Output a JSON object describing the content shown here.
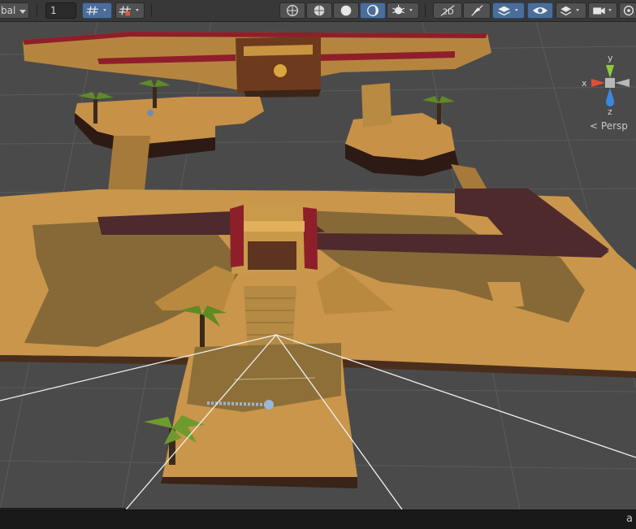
{
  "toolbar": {
    "pivot_rotation_label": "bal",
    "grid_snap_increment": "1",
    "buttons": [
      {
        "name": "grid-toggle-icon",
        "active": true
      },
      {
        "name": "incremental-snap-icon",
        "active": false
      },
      {
        "name": "draw-mode-wireframe-icon",
        "active": false
      },
      {
        "name": "draw-mode-shaded-wireframe-icon",
        "active": false
      },
      {
        "name": "draw-mode-shaded-icon",
        "active": false
      },
      {
        "name": "draw-mode-unlit-icon",
        "active": true
      },
      {
        "name": "render-debug-icon",
        "active": false
      },
      {
        "name": "2d-toggle-icon",
        "active": false
      },
      {
        "name": "lighting-toggle-icon",
        "active": false
      },
      {
        "name": "layers-effects-icon",
        "active": true
      },
      {
        "name": "scene-visibility-icon",
        "active": true
      },
      {
        "name": "overlays-icon",
        "active": false
      },
      {
        "name": "camera-icon",
        "active": false
      },
      {
        "name": "scene-view-options-icon",
        "active": false
      }
    ]
  },
  "gizmo": {
    "axis_y": "y",
    "axis_x": "x",
    "axis_z": "z",
    "projection_label": "Persp",
    "colors": {
      "x": "#e64d37",
      "y": "#8ccc3a",
      "z": "#3a87e0",
      "neutral": "#b8b8b8"
    }
  },
  "navigation_bar": {
    "items": [
      {
        "name": "orbit-icon",
        "active": false
      },
      {
        "name": "surface-snap-icon",
        "active": true
      },
      {
        "name": "zoom-icon",
        "active": false
      },
      {
        "name": "move-icon",
        "active": true
      },
      {
        "name": "camera-view-icon",
        "active": true
      }
    ]
  },
  "status_bar": {
    "glyph": "a"
  }
}
